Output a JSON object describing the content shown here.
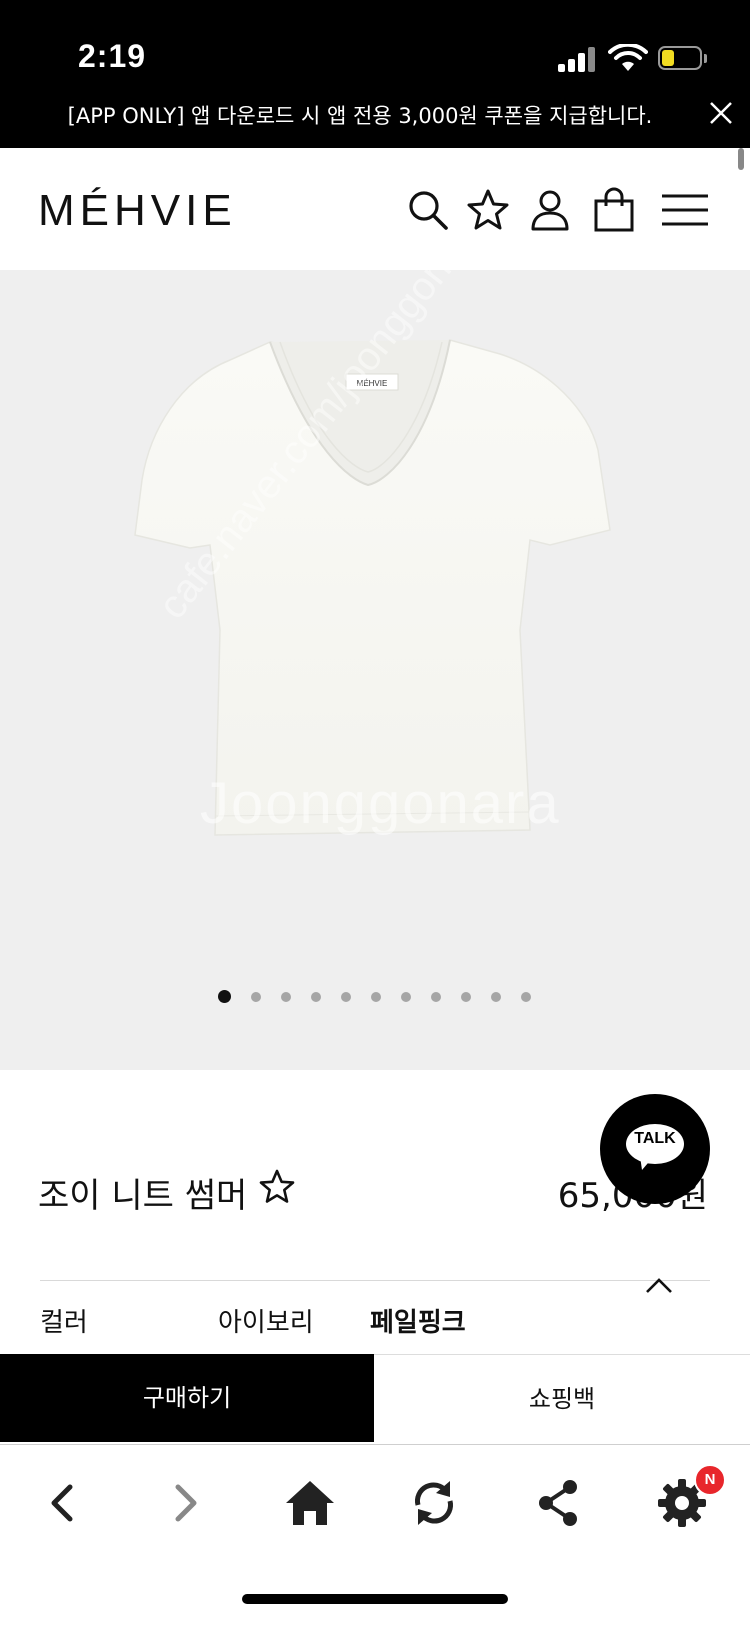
{
  "status_bar": {
    "time": "2:19"
  },
  "banner": {
    "text": "[APP ONLY] 앱 다운로드 시 앱 전용 3,000원 쿠폰을 지급합니다."
  },
  "header": {
    "logo": "MÉHVIE",
    "icons": [
      "search-icon",
      "star-icon",
      "user-icon",
      "shopping-bag-icon",
      "menu-icon"
    ]
  },
  "gallery": {
    "garment_label": "MÉHVIE",
    "watermark": "Joonggonara",
    "watermark_diag": "cafe.naver.com/joonggonara",
    "slide_count": 11,
    "active_slide": 1
  },
  "product": {
    "name": "조이 니트 썸머",
    "price": "65,000원"
  },
  "talk": {
    "label": "TALK"
  },
  "options": {
    "label": "컬러",
    "values": [
      "아이보리",
      "페일핑크"
    ],
    "selected": "페일핑크"
  },
  "actions": {
    "buy": "구매하기",
    "bag": "쇼핑백"
  },
  "browser_toolbar": {
    "icons": [
      "back-icon",
      "forward-icon",
      "home-icon",
      "refresh-icon",
      "share-icon",
      "settings-icon"
    ],
    "badge": "N"
  },
  "colors": {
    "black": "#000000",
    "gallery_bg": "#efefef",
    "badge_red": "#e8262b",
    "battery_yellow": "#f2dc21"
  }
}
